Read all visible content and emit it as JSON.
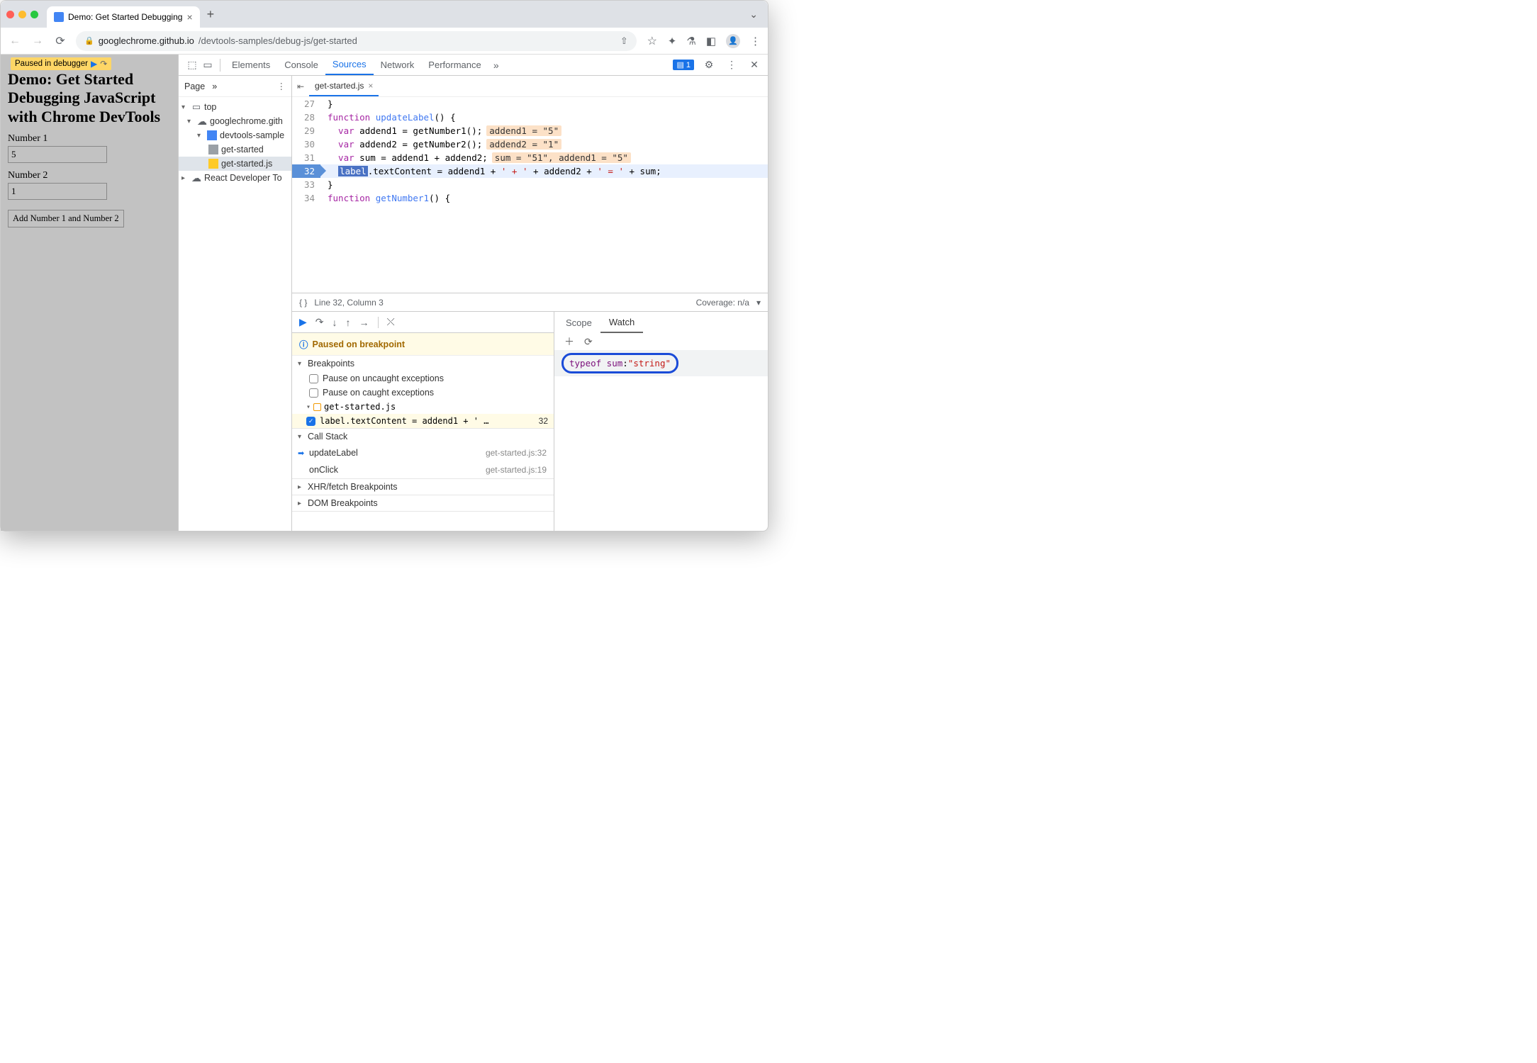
{
  "browser": {
    "tab_title": "Demo: Get Started Debugging",
    "url_host": "googlechrome.github.io",
    "url_path": "/devtools-samples/debug-js/get-started"
  },
  "page": {
    "paused_badge": "Paused in debugger",
    "heading": "Demo: Get Started Debugging JavaScript with Chrome DevTools",
    "label1": "Number 1",
    "value1": "5",
    "label2": "Number 2",
    "value2": "1",
    "button": "Add Number 1 and Number 2"
  },
  "devtools": {
    "tabs": {
      "elements": "Elements",
      "console": "Console",
      "sources": "Sources",
      "network": "Network",
      "performance": "Performance"
    },
    "issues_count": "1",
    "navigator": {
      "header": "Page",
      "items": {
        "top": "top",
        "domain": "googlechrome.gith",
        "folder": "devtools-sample",
        "file_html": "get-started",
        "file_js": "get-started.js",
        "react": "React Developer To"
      }
    },
    "editor": {
      "filename": "get-started.js",
      "lines": [
        {
          "n": "27",
          "t": "}"
        },
        {
          "n": "28",
          "t_kw": "function",
          "t_fn": " updateLabel",
          "t_rest": "() {"
        },
        {
          "n": "29",
          "t_kw": "  var",
          "t_mid": " addend1 = getNumber1();",
          "ov": "addend1 = \"5\""
        },
        {
          "n": "30",
          "t_kw": "  var",
          "t_mid": " addend2 = getNumber2();",
          "ov": "addend2 = \"1\""
        },
        {
          "n": "31",
          "t_kw": "  var",
          "t_mid": " sum = addend1 + addend2;",
          "ov": "sum = \"51\", addend1 = \"5\""
        },
        {
          "n": "32",
          "exec": true,
          "sel": "label",
          "t_mid": ".textContent = addend1 + ",
          "str1": "' + '",
          "t_mid2": " + addend2 + ",
          "str2": "' = '",
          "t_end": " + sum;"
        },
        {
          "n": "33",
          "t": "}"
        },
        {
          "n": "34",
          "t_kw": "function",
          "t_fn": " getNumber1",
          "t_rest": "() {"
        }
      ],
      "status_pos": "Line 32, Column 3",
      "coverage": "Coverage: n/a"
    },
    "debugger": {
      "paused_msg": "Paused on breakpoint",
      "sections": {
        "breakpoints": "Breakpoints",
        "pause_uncaught": "Pause on uncaught exceptions",
        "pause_caught": "Pause on caught exceptions",
        "bp_file": "get-started.js",
        "bp_code": "label.textContent = addend1 + ' …",
        "bp_line": "32",
        "callstack": "Call Stack",
        "frame1": "updateLabel",
        "frame1_loc": "get-started.js:32",
        "frame2": "onClick",
        "frame2_loc": "get-started.js:19",
        "xhr": "XHR/fetch Breakpoints",
        "dom": "DOM Breakpoints"
      }
    },
    "watch": {
      "tabs": {
        "scope": "Scope",
        "watch": "Watch"
      },
      "expr": "typeof sum",
      "value": "\"string\""
    }
  }
}
